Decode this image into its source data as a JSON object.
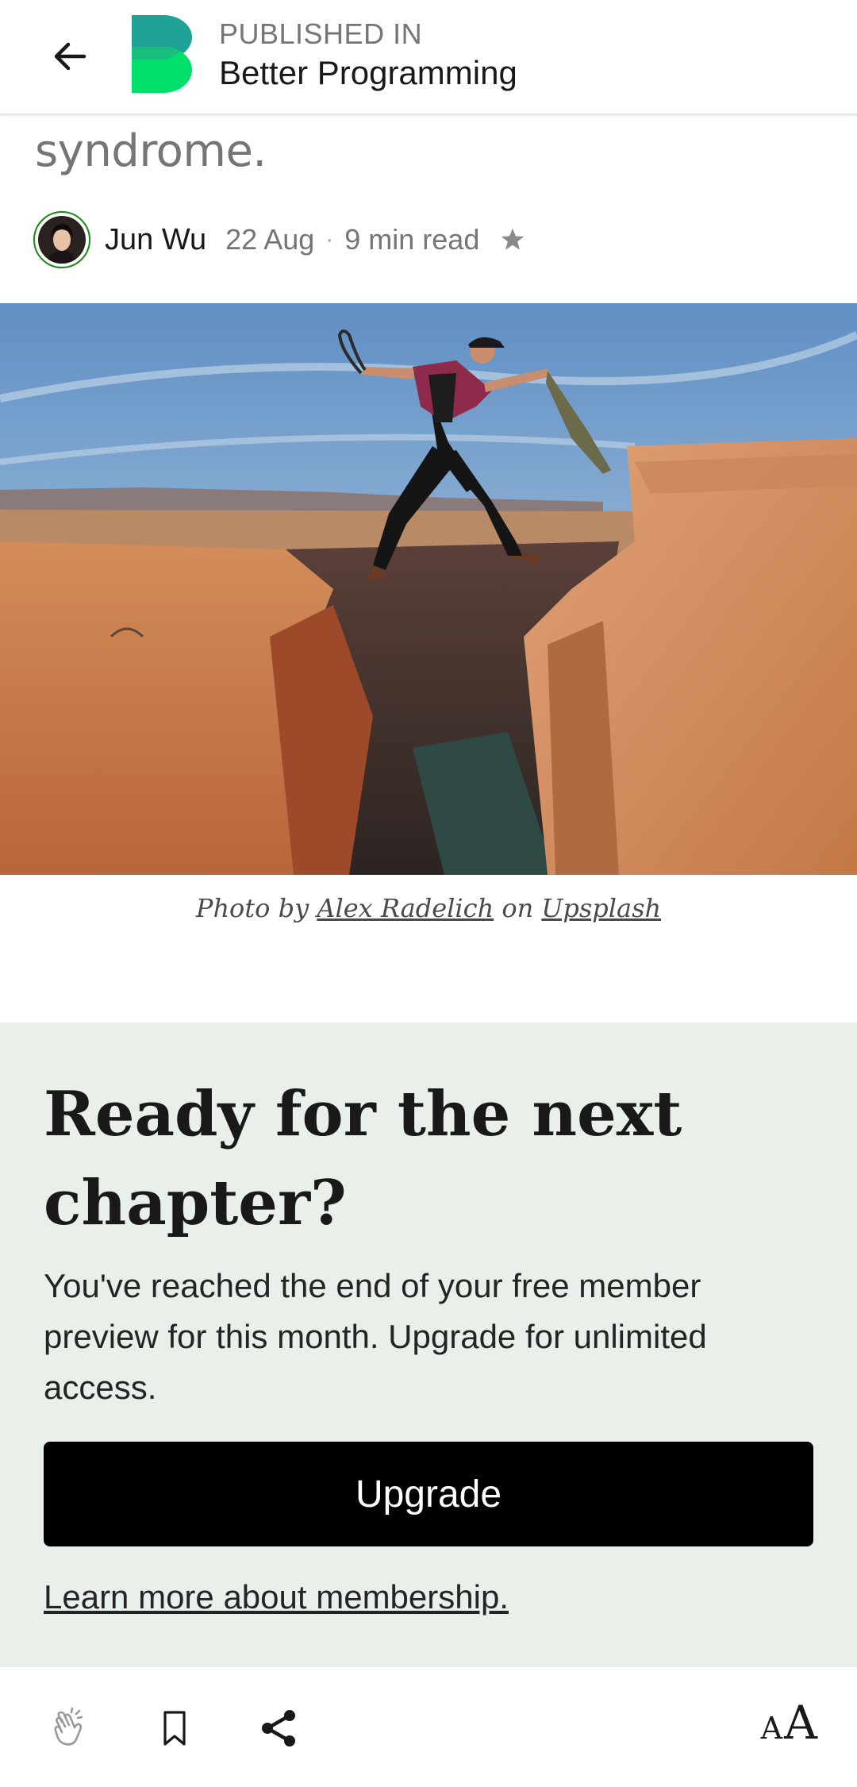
{
  "header": {
    "publication_label": "PUBLISHED IN",
    "publication_name": "Better Programming"
  },
  "article": {
    "title_fragment": "syndrome.",
    "author": "Jun Wu",
    "date": "22 Aug",
    "separator": "·",
    "read_time": "9 min read"
  },
  "caption": {
    "prefix": "Photo by",
    "photographer": "Alex Radelich",
    "middle": "on",
    "source": "Upsplash"
  },
  "paywall": {
    "title": "Ready for the next chapter?",
    "text": "You've reached the end of your free member preview for this month. Upgrade for unlimited access.",
    "button_label": "Upgrade",
    "learn_more": "Learn more about membership."
  },
  "toolbar": {
    "font_small": "A",
    "font_big": "A"
  },
  "colors": {
    "paywall_bg": "#e8f0e9",
    "logo_green": "#00e06a",
    "logo_teal": "#1fa396",
    "button_bg": "#000000"
  },
  "icons": [
    "back-arrow-icon",
    "publication-logo-icon",
    "star-icon",
    "clap-icon",
    "bookmark-icon",
    "share-icon",
    "font-size-icon"
  ]
}
